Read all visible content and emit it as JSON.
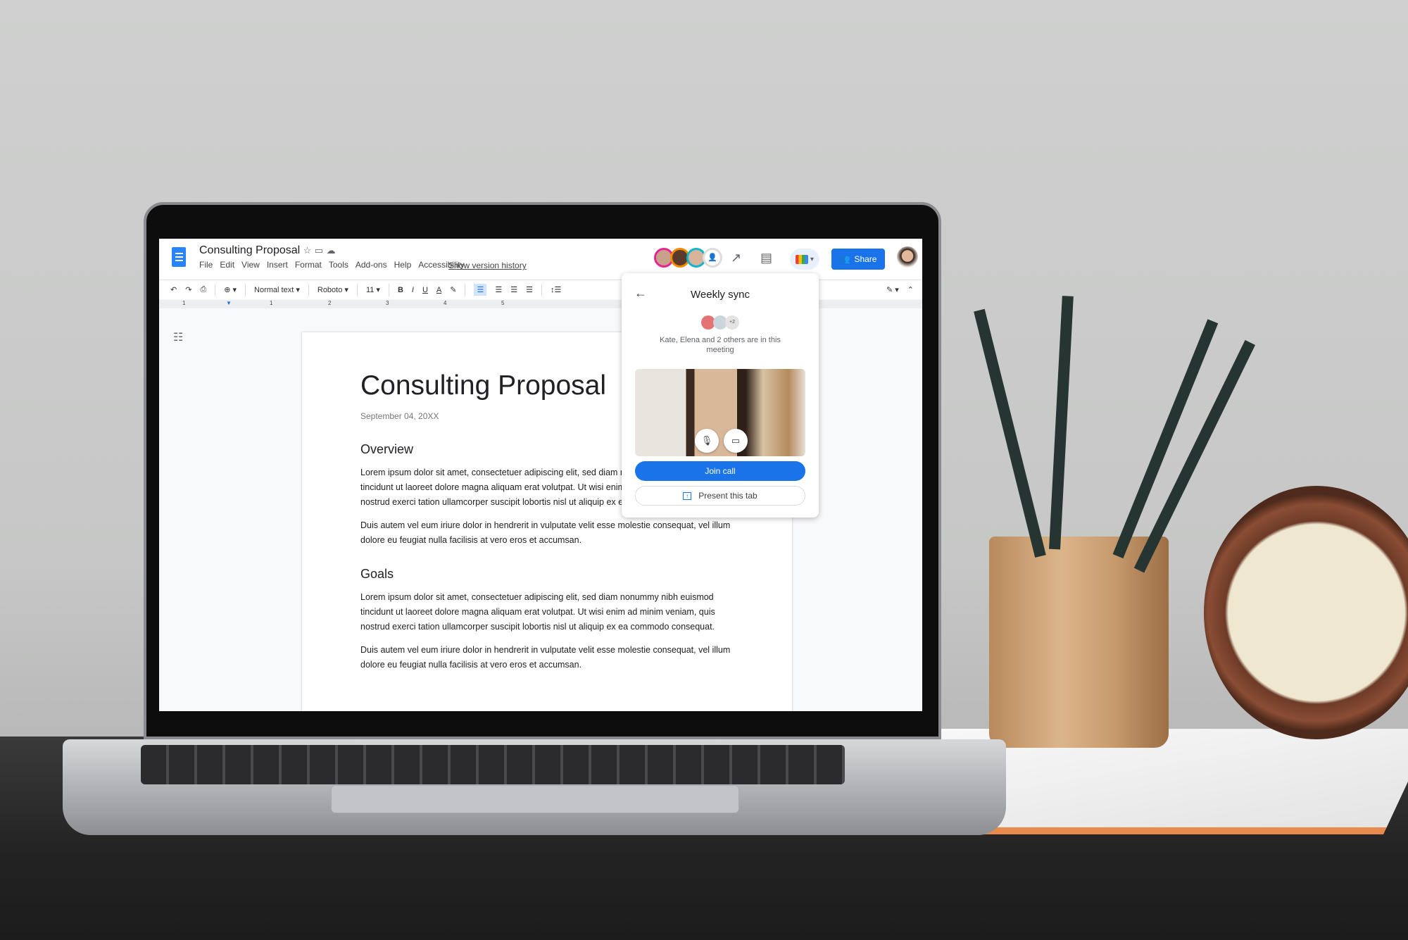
{
  "document": {
    "title": "Consulting Proposal",
    "menu": [
      "File",
      "Edit",
      "View",
      "Insert",
      "Format",
      "Tools",
      "Add-ons",
      "Help",
      "Accessibility"
    ],
    "version_history_link": "Show version history",
    "share_label": "Share",
    "toolbar": {
      "style": "Normal text",
      "font": "Roboto",
      "size": "11"
    },
    "ruler_ticks": [
      "1",
      "1",
      "2",
      "3",
      "4",
      "5"
    ],
    "body": {
      "heading": "Consulting Proposal",
      "date": "September 04, 20XX",
      "sections": [
        {
          "title": "Overview",
          "paragraphs": [
            "Lorem ipsum dolor sit amet, consectetuer adipiscing elit, sed diam nonummy nibh euismod tincidunt ut laoreet dolore magna aliquam erat volutpat. Ut wisi enim ad minim veniam, quis nostrud exerci tation ullamcorper suscipit lobortis nisl ut aliquip ex ea commodo consequat.",
            "Duis autem vel eum iriure dolor in hendrerit in vulputate velit esse molestie consequat, vel illum dolore eu feugiat nulla facilisis at vero eros et accumsan."
          ]
        },
        {
          "title": "Goals",
          "paragraphs": [
            "Lorem ipsum dolor sit amet, consectetuer adipiscing elit, sed diam nonummy nibh euismod tincidunt ut laoreet dolore magna aliquam erat volutpat. Ut wisi enim ad minim veniam, quis nostrud exerci tation ullamcorper suscipit lobortis nisl ut aliquip ex ea commodo consequat.",
            "Duis autem vel eum iriure dolor in hendrerit in vulputate velit esse molestie consequat, vel illum dolore eu feugiat nulla facilisis at vero eros et accumsan."
          ]
        }
      ]
    }
  },
  "meet_popup": {
    "title": "Weekly sync",
    "extra_participants": "+2",
    "status": "Kate, Elena and 2 others are in this meeting",
    "join_label": "Join call",
    "present_label": "Present this tab"
  },
  "colors": {
    "accent": "#1a73e8",
    "docs_blue": "#2684fc"
  }
}
